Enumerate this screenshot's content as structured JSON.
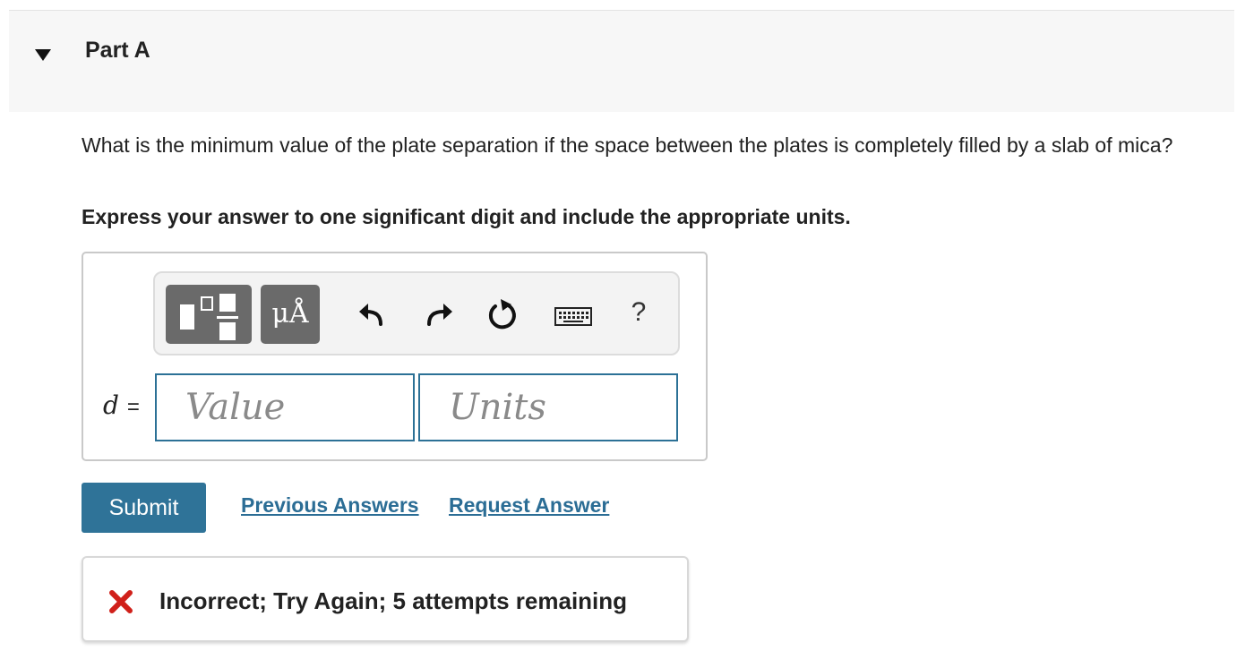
{
  "part": {
    "title": "Part A",
    "toggle_icon": "triangle-down-icon"
  },
  "question": {
    "text": "What is the minimum value of the plate separation if the space between the plates is completely filled by a slab of mica?",
    "instruction": "Express your answer to one significant digit and include the appropriate units."
  },
  "toolbar": {
    "templates_icon": "templates-icon",
    "units_label": "μÅ",
    "undo_icon": "undo-icon",
    "redo_icon": "redo-icon",
    "reset_icon": "reset-icon",
    "keyboard_icon": "keyboard-icon",
    "help_label": "?"
  },
  "answer": {
    "variable": "d",
    "equals": "=",
    "value_placeholder": "Value",
    "units_placeholder": "Units"
  },
  "actions": {
    "submit_label": "Submit",
    "previous_answers_label": "Previous Answers",
    "request_answer_label": "Request Answer"
  },
  "feedback": {
    "icon": "x-icon",
    "text": "Incorrect; Try Again; 5 attempts remaining",
    "icon_color": "#d0201a"
  },
  "colors": {
    "accent": "#2f7398",
    "link": "#2b6d95",
    "field_border": "#2c7196"
  }
}
